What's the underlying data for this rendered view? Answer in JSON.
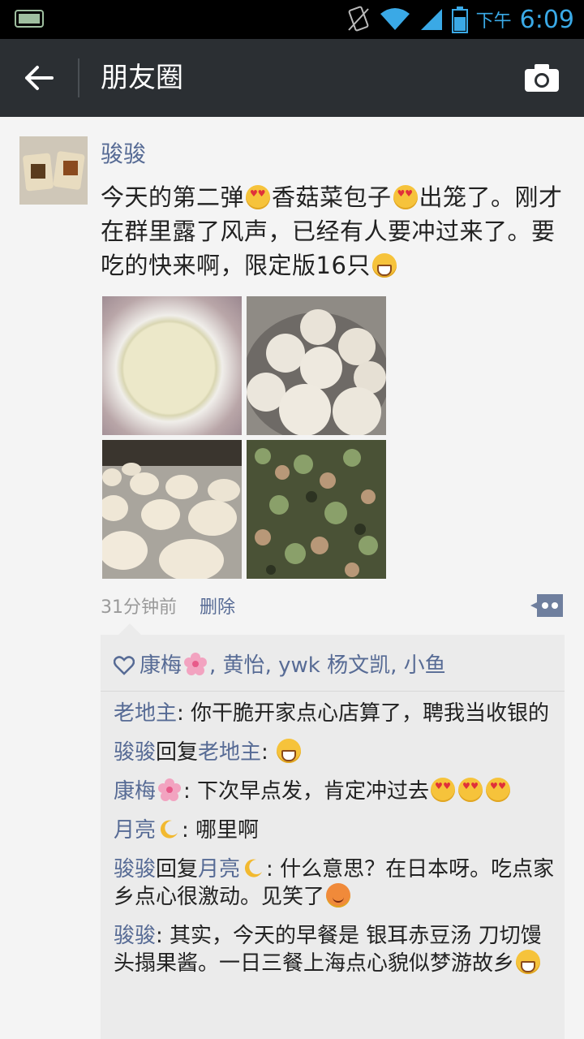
{
  "status_bar": {
    "ampm": "下午",
    "time": "6:09",
    "accent_color": "#3aa9e6"
  },
  "header": {
    "title": "朋友圈",
    "back_icon": "arrow-left-icon",
    "camera_icon": "camera-icon"
  },
  "post": {
    "author": "骏骏",
    "text_parts": [
      "今天的第二弹",
      "香菇菜包子",
      "出笼了。刚才在群里露了风声，已经有人要冲过来了。要吃的快来啊，限定版16只"
    ],
    "photo_count": 4,
    "time_ago": "31分钟前",
    "delete_label": "删除",
    "likes": {
      "names": [
        "康梅",
        "黄怡",
        "ywk 杨文凯",
        "小鱼"
      ],
      "sep": ", "
    },
    "comments": [
      {
        "name": "老地主",
        "text": ": 你干脆开家点心店算了，聘我当收银的"
      },
      {
        "name": "骏骏",
        "reply_word": "回复",
        "reply_to": "老地主",
        "text": ": "
      },
      {
        "name": "康梅",
        "text": ": 下次早点发，肯定冲过去"
      },
      {
        "name": "月亮",
        "text": ": 哪里啊"
      },
      {
        "name": "骏骏",
        "reply_word": "回复",
        "reply_to": "月亮",
        "text": ": 什么意思？在日本呀。吃点家乡点心很激动。见笑了"
      },
      {
        "name": "骏骏",
        "text": ": 其实，今天的早餐是 银耳赤豆汤 刀切馒头搨果酱。一日三餐上海点心貌似梦游故乡"
      }
    ]
  },
  "colors": {
    "link": "#576b95",
    "header_bg": "#2b2f33",
    "page_bg": "#f4f4f4",
    "panel_bg": "#ebebeb"
  }
}
